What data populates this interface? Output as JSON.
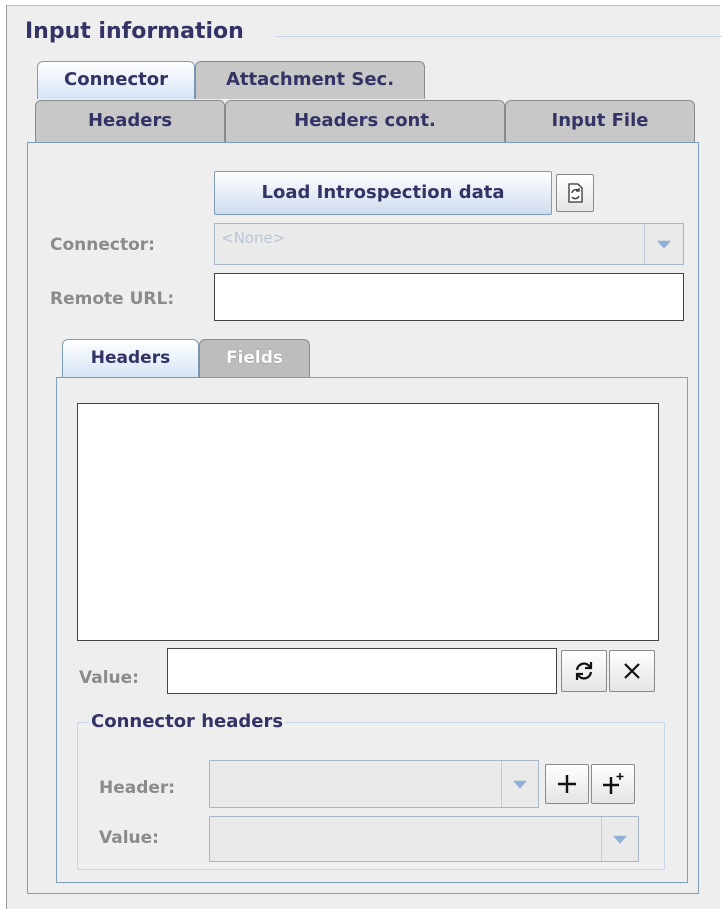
{
  "section_title": "Input information",
  "outer_tabs": {
    "row1": [
      "Connector",
      "Attachment Sec."
    ],
    "row2": [
      "Headers",
      "Headers cont.",
      "Input File"
    ],
    "active": "Connector"
  },
  "toolbar": {
    "load_button_label": "Load Introspection data",
    "refresh_icon": "refresh-document-icon"
  },
  "connector": {
    "label": "Connector:",
    "selected": "<None>"
  },
  "remote_url": {
    "label": "Remote URL:",
    "value": ""
  },
  "inner_tabs": {
    "items": [
      "Headers",
      "Fields"
    ],
    "active": "Headers"
  },
  "headers_panel": {
    "list_items": [],
    "value_label": "Value:",
    "value": "",
    "apply_icon": "refresh-arrows-icon",
    "clear_icon": "close-icon"
  },
  "connector_headers": {
    "title": "Connector headers",
    "header_label": "Header:",
    "value_label": "Value:",
    "add_icon": "plus-icon",
    "add_all_icon": "plus-star-icon"
  },
  "colors": {
    "title_text": "#333366",
    "label_text": "#8b8b8b",
    "panel_border": "#7f9db9",
    "background": "#eeeeee"
  }
}
